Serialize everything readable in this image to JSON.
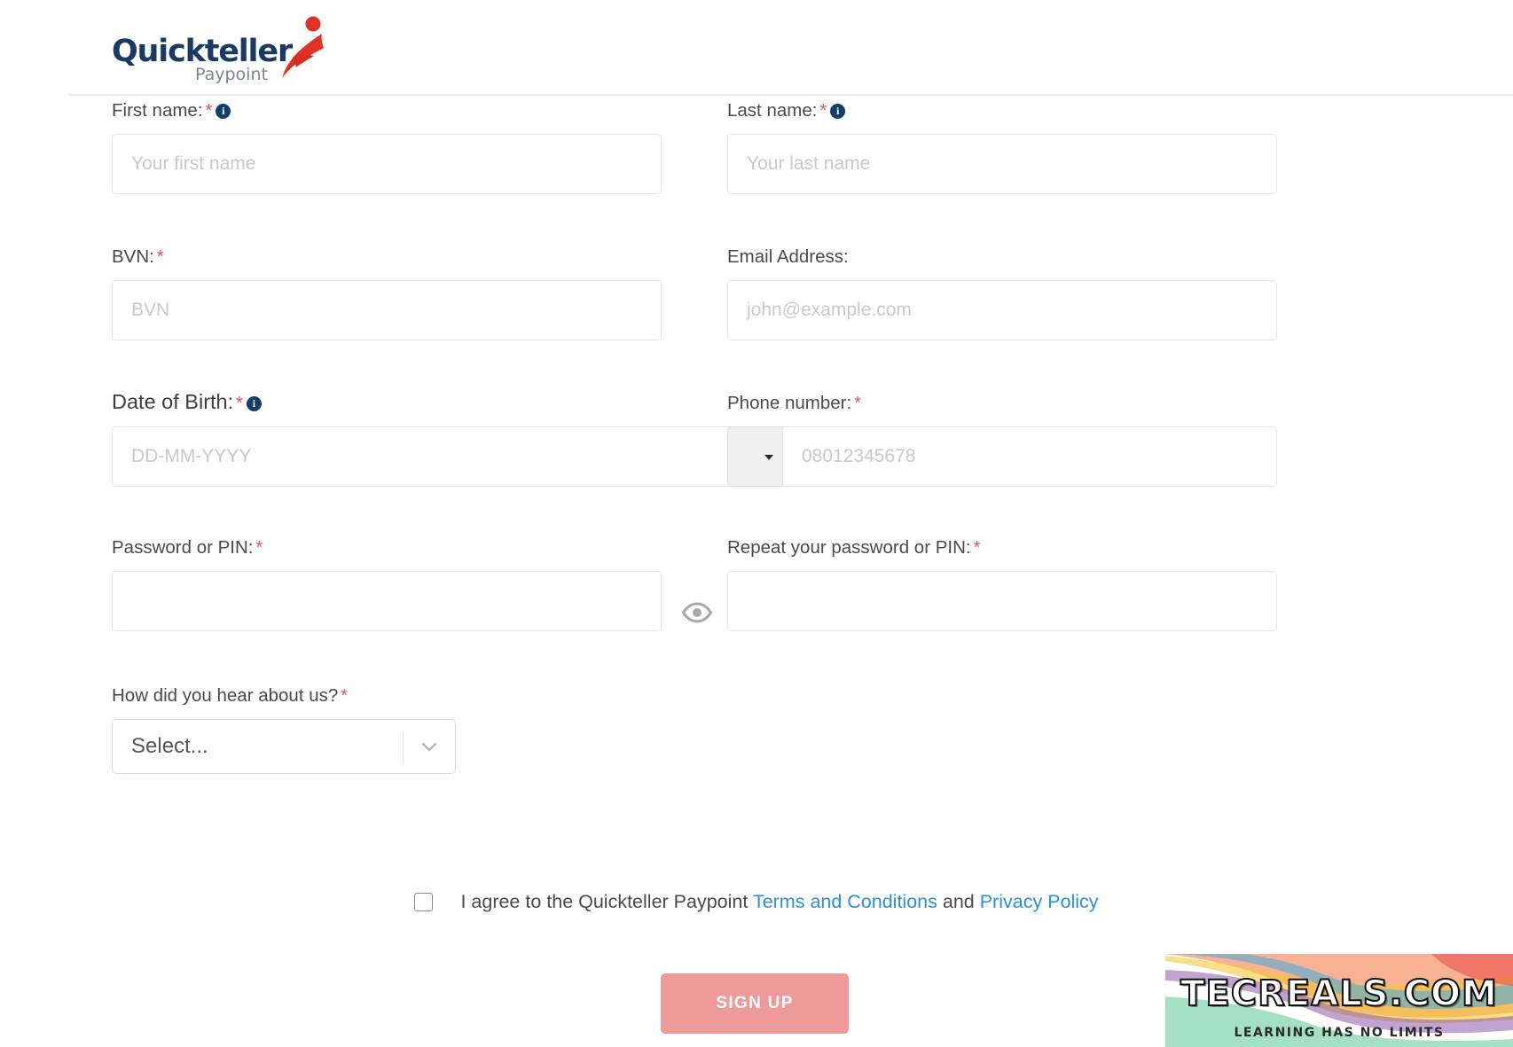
{
  "brand": {
    "name": "Quickteller",
    "sub": "Paypoint",
    "navy": "#1b3a63",
    "gray": "#7b8794",
    "red": "#e03127"
  },
  "form": {
    "fields": {
      "first_name": {
        "label": "First name:",
        "required": "*",
        "info": "i",
        "placeholder": "Your first name",
        "value": ""
      },
      "last_name": {
        "label": "Last name:",
        "required": "*",
        "info": "i",
        "placeholder": "Your last name",
        "value": ""
      },
      "bvn": {
        "label": "BVN:",
        "required": "*",
        "placeholder": "BVN",
        "value": ""
      },
      "email": {
        "label": "Email Address:",
        "placeholder": "john@example.com",
        "value": ""
      },
      "dob": {
        "label": "Date of Birth:",
        "required": "*",
        "info": "i",
        "placeholder": "DD-MM-YYYY",
        "value": ""
      },
      "phone": {
        "label": "Phone number:",
        "required": "*",
        "placeholder": "08012345678",
        "value": "",
        "country_code_value": ""
      },
      "password": {
        "label": "Password or PIN:",
        "required": "*",
        "placeholder": "",
        "value": ""
      },
      "repeat_password": {
        "label": "Repeat your password or PIN:",
        "required": "*",
        "placeholder": "",
        "value": ""
      },
      "referral": {
        "label": "How did you hear about us?",
        "required": "*",
        "selected": "Select..."
      }
    },
    "terms": {
      "prefix": "I agree to the Quickteller Paypoint",
      "terms_link": "Terms and Conditions",
      "conjunction": "and",
      "privacy_link": "Privacy Policy",
      "checked": false
    },
    "submit": {
      "label": "SIGN UP",
      "color": "#ef9a9a"
    }
  },
  "watermark": {
    "title": "TECREALS.COM",
    "tagline": "LEARNING HAS NO LIMITS"
  }
}
